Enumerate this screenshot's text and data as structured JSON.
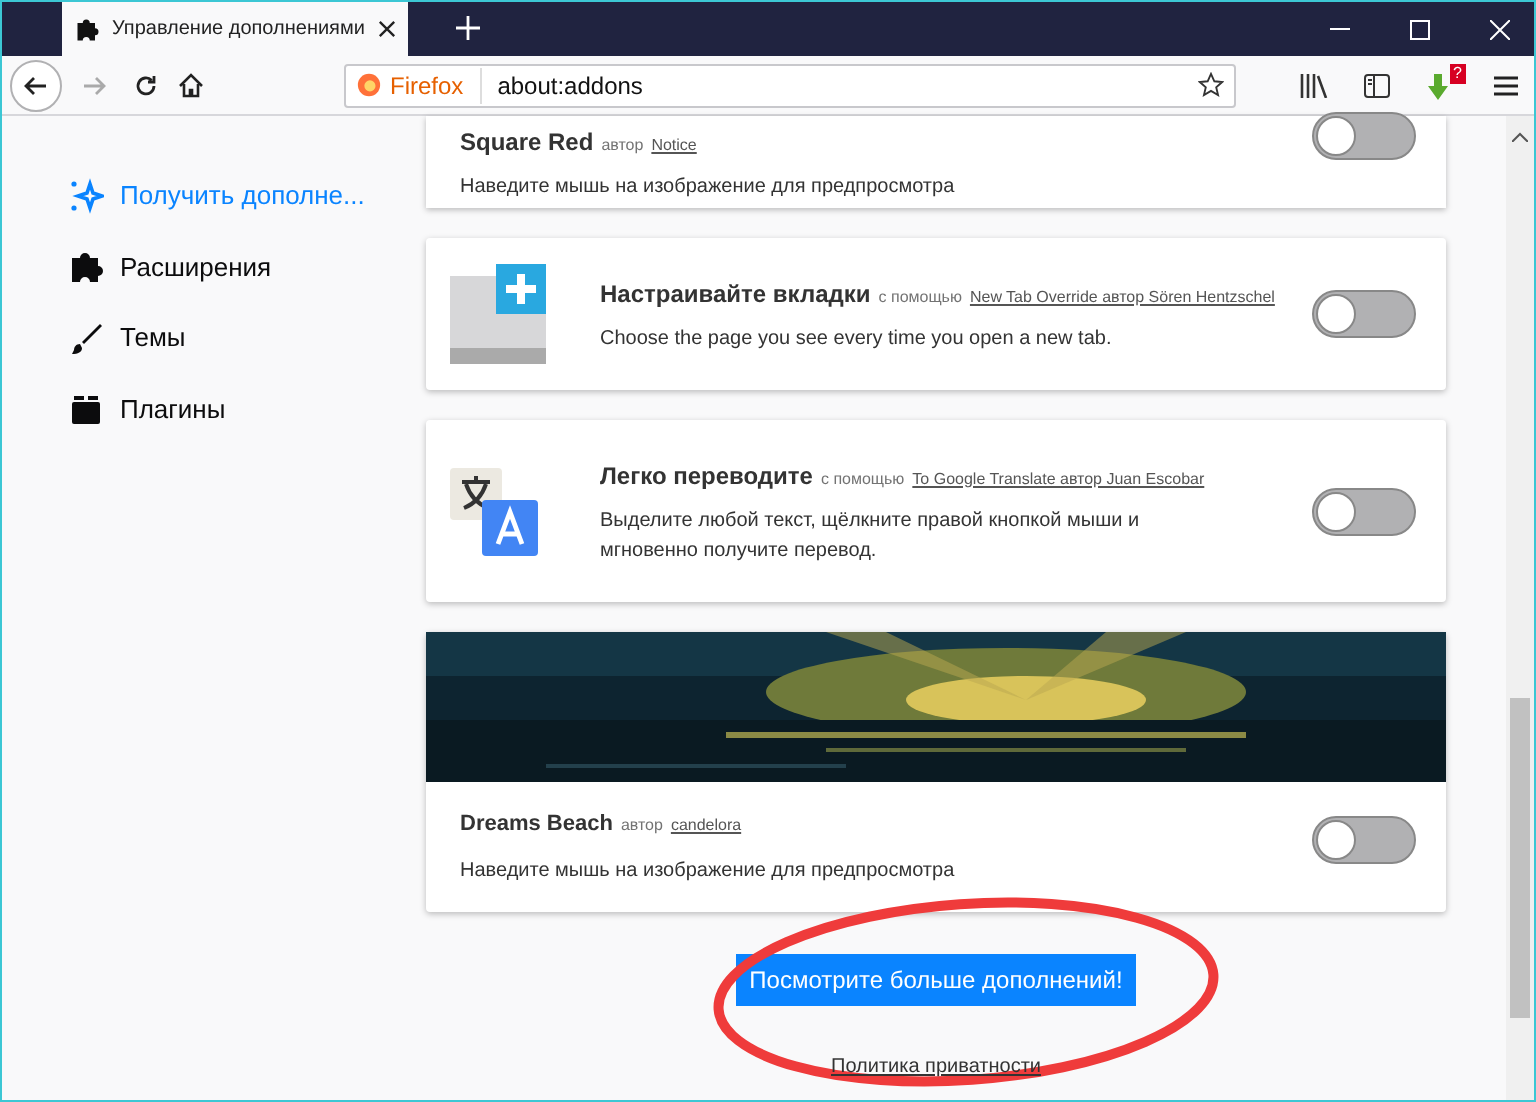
{
  "tab": {
    "title": "Управление дополнениями"
  },
  "toolbar": {
    "identity": "Firefox",
    "url": "about:addons",
    "badge": "?"
  },
  "sidebar": {
    "items": [
      {
        "label": "Получить дополне...",
        "kind": "discover",
        "selected": true
      },
      {
        "label": "Расширения",
        "kind": "extensions",
        "selected": false
      },
      {
        "label": "Темы",
        "kind": "themes",
        "selected": false
      },
      {
        "label": "Плагины",
        "kind": "plugins",
        "selected": false
      }
    ]
  },
  "cards": [
    {
      "kind": "cut",
      "title": "Square Red",
      "by": "автор",
      "link": "Notice",
      "description": "Наведите мышь на изображение для предпросмотра",
      "on": false
    },
    {
      "kind": "newtab",
      "title": "Настраивайте вкладки",
      "by": "с помощью",
      "link": "New Tab Override автор Sören Hentzschel",
      "description": "Choose the page you see every time you open a new tab.",
      "on": false
    },
    {
      "kind": "translate",
      "title": "Легко переводите",
      "by": "с помощью",
      "link": "To Google Translate автор Juan Escobar",
      "description": "Выделите любой текст, щёлкните правой кнопкой мыши и мгновенно получите перевод.",
      "on": false
    },
    {
      "kind": "theme",
      "title": "Dreams Beach",
      "by": "автор",
      "link": "candelora",
      "description": "Наведите мышь на изображение для предпросмотра",
      "on": false
    }
  ],
  "more_button": "Посмотрите больше дополнений!",
  "privacy_link": "Политика приватности"
}
